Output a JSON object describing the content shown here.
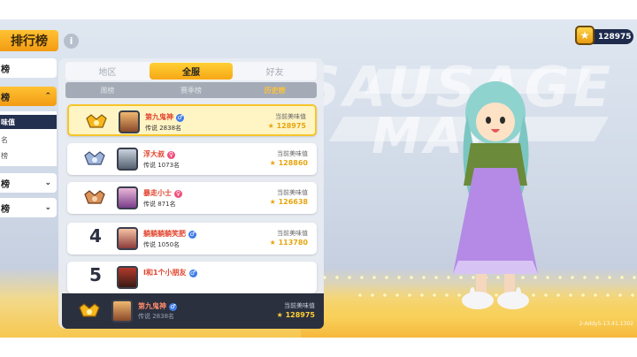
{
  "header": {
    "title": "排行榜",
    "info_icon": "i",
    "currency": {
      "icon": "star-coin-icon",
      "value": "128975"
    }
  },
  "sidebar": {
    "categories": [
      {
        "label": "榜",
        "chevron": ""
      },
      {
        "label": "榜",
        "chevron": "⌃"
      },
      {
        "label": "榜",
        "chevron": "⌄"
      },
      {
        "label": "榜",
        "chevron": "⌄"
      }
    ],
    "subitems": [
      "味值",
      "名",
      "榜"
    ]
  },
  "scope_tabs": [
    "地区",
    "全服",
    "好友"
  ],
  "sub_tabs": [
    "周榜",
    "赛季榜",
    "历史榜"
  ],
  "entries": [
    {
      "rank": "1",
      "badge": "gold-crown-badge-icon",
      "name": "第九鬼神",
      "gender": "♂",
      "gender_type": "m",
      "sub": "传说 2838名",
      "score_label": "当前美味值",
      "score": "128975"
    },
    {
      "rank": "2",
      "badge": "silver-crown-badge-icon",
      "name": "浮大叔",
      "gender": "♀",
      "gender_type": "f",
      "sub": "传说 1073名",
      "score_label": "当前美味值",
      "score": "128860"
    },
    {
      "rank": "3",
      "badge": "bronze-crown-badge-icon",
      "name": "暴走小士",
      "gender": "♀",
      "gender_type": "f",
      "sub": "传说 871名",
      "score_label": "当前美味值",
      "score": "126638"
    },
    {
      "rank": "4",
      "badge": "",
      "name": "躺躺躺躺笑肥",
      "gender": "♂",
      "gender_type": "m",
      "sub": "传说 1050名",
      "score_label": "当前美味值",
      "score": "113780"
    },
    {
      "rank": "5",
      "badge": "",
      "name": "I和1个小朋友",
      "gender": "♂",
      "gender_type": "m",
      "sub": "",
      "score_label": "",
      "score": ""
    }
  ],
  "my_entry": {
    "badge": "gold-crown-badge-icon",
    "name": "第九鬼神",
    "gender": "♂",
    "sub": "传说 2838名",
    "score_label": "当前美味值",
    "score": "128975"
  },
  "background_text": {
    "line1": "SAUSAGE",
    "line2": "MAN"
  },
  "version": "2-Addy5-13.41.1302",
  "colors": {
    "accent": "#F6A716",
    "dark": "#2B303F",
    "name_red": "#E2452F",
    "score_gold": "#E6A510"
  }
}
